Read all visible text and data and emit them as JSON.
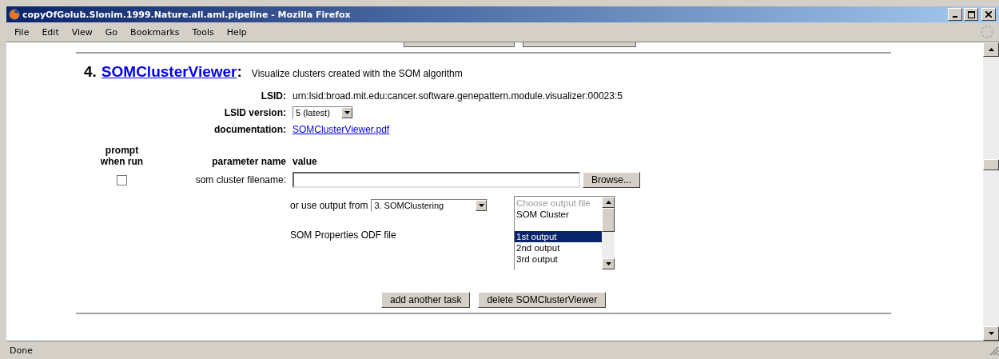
{
  "window": {
    "title": "copyOfGolub.Slonim.1999.Nature.all.aml.pipeline - Mozilla Firefox"
  },
  "menu": [
    "File",
    "Edit",
    "View",
    "Go",
    "Bookmarks",
    "Tools",
    "Help"
  ],
  "task": {
    "number": "4.",
    "name": "SOMClusterViewer",
    "colon": ":",
    "description": "Visualize clusters created with the SOM algorithm",
    "fields": [
      {
        "label": "LSID:",
        "kind": "text",
        "value": "urn:lsid:broad.mit.edu:cancer.software.genepattern.module.visualizer:00023:5"
      },
      {
        "label": "LSID version:",
        "kind": "select",
        "value": "5 (latest)"
      },
      {
        "label": "documentation:",
        "kind": "link",
        "value": "SOMClusterViewer.pdf"
      }
    ],
    "headers": {
      "prompt": "prompt when run",
      "parameter": "parameter name",
      "value": "value"
    },
    "parameter": {
      "prompt_checked": false,
      "name": "som cluster filename:",
      "browse": "Browse..."
    },
    "output_from": {
      "label": "or use output from",
      "selected": "3. SOMClustering",
      "file_type": "SOM Properties ODF file",
      "options": [
        {
          "label": "Choose output file",
          "disabled": true,
          "selected": false,
          "gap_before": false
        },
        {
          "label": "SOM Cluster",
          "disabled": false,
          "selected": false,
          "gap_before": false
        },
        {
          "label": "1st output",
          "disabled": false,
          "selected": true,
          "gap_before": true
        },
        {
          "label": "2nd output",
          "disabled": false,
          "selected": false,
          "gap_before": false
        },
        {
          "label": "3rd output",
          "disabled": false,
          "selected": false,
          "gap_before": false
        }
      ]
    },
    "buttons": [
      "add another task",
      "delete SOMClusterViewer"
    ]
  },
  "status_bar": "Done"
}
